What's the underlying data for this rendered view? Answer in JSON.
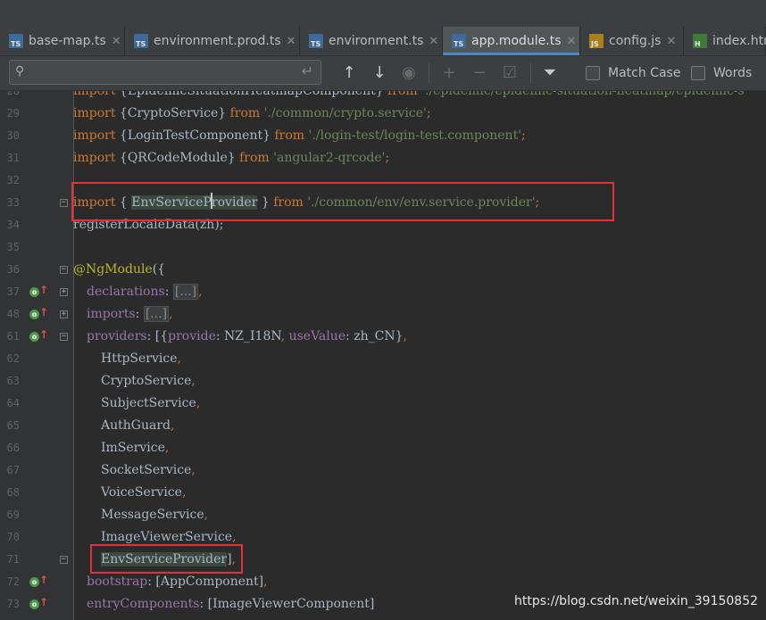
{
  "tabs": [
    {
      "label": "base-map.ts",
      "icon": "ts",
      "active": false
    },
    {
      "label": "environment.prod.ts",
      "icon": "ts",
      "active": false
    },
    {
      "label": "environment.ts",
      "icon": "ts",
      "active": false
    },
    {
      "label": "app.module.ts",
      "icon": "ts",
      "active": true
    },
    {
      "label": "config.js",
      "icon": "js",
      "active": false
    },
    {
      "label": "index.htm",
      "icon": "html",
      "active": false
    }
  ],
  "search": {
    "value": "",
    "match_case_label": "Match Case",
    "words_label": "Words",
    "match_case_checked": false,
    "words_checked": false
  },
  "lines": [
    {
      "num": "28",
      "text": "import {EpidemicSituationHeatmapComponent} from './epidemic/epidemic-situation-heatmap/epidemic-s"
    },
    {
      "num": "29",
      "text": "import {CryptoService} from './common/crypto.service';"
    },
    {
      "num": "30",
      "text": "import {LoginTestComponent} from './login-test/login-test.component';"
    },
    {
      "num": "31",
      "text": "import {QRCodeModule} from 'angular2-qrcode';"
    },
    {
      "num": "32",
      "text": ""
    },
    {
      "num": "33",
      "text": "import { EnvServiceProvider } from './common/env/env.service.provider';"
    },
    {
      "num": "34",
      "text": "registerLocaleData(zh);"
    },
    {
      "num": "35",
      "text": ""
    },
    {
      "num": "36",
      "text": "@NgModule({"
    },
    {
      "num": "37",
      "text": "declarations: [...],"
    },
    {
      "num": "48",
      "text": "imports: [...],"
    },
    {
      "num": "61",
      "text": "providers: [{provide: NZ_I18N, useValue: zh_CN},"
    },
    {
      "num": "62",
      "text": "HttpService,"
    },
    {
      "num": "63",
      "text": "CryptoService,"
    },
    {
      "num": "64",
      "text": "SubjectService,"
    },
    {
      "num": "65",
      "text": "AuthGuard,"
    },
    {
      "num": "66",
      "text": "ImService,"
    },
    {
      "num": "67",
      "text": "SocketService,"
    },
    {
      "num": "68",
      "text": "VoiceService,"
    },
    {
      "num": "69",
      "text": "MessageService,"
    },
    {
      "num": "70",
      "text": "ImageViewerService,"
    },
    {
      "num": "71",
      "text": "EnvServiceProvider],"
    },
    {
      "num": "72",
      "text": "bootstrap: [AppComponent],"
    },
    {
      "num": "73",
      "text": "entryComponents: [ImageViewerComponent]"
    }
  ],
  "code": {
    "l28": {
      "kw1": "import",
      "mid": " {EpidemicSituationHeatmapComponent} ",
      "kw2": "from",
      "str": " './epidemic/epidemic-situation-heatmap/epidemic-s"
    },
    "l29": {
      "kw1": "import",
      "mid": " {CryptoService} ",
      "kw2": "from",
      "str": " './common/crypto.service'",
      "end": ";"
    },
    "l30": {
      "kw1": "import",
      "mid": " {LoginTestComponent} ",
      "kw2": "from",
      "str": " './login-test/login-test.component'",
      "end": ";"
    },
    "l31": {
      "kw1": "import",
      "mid": " {QRCodeModule} ",
      "kw2": "from",
      "str": " 'angular2-qrcode'",
      "end": ";"
    },
    "l33": {
      "kw1": "import",
      "mid1": " { ",
      "hl_a": "EnvServiceP",
      "hl_b": "rovider",
      "mid2": " } ",
      "kw2": "from",
      "str": " './common/env/env.service.provider'",
      "end": ";"
    },
    "l34": {
      "text": "registerLocaleData(zh);"
    },
    "l36": {
      "ann": "@NgModule",
      "rest": "({"
    },
    "l37": {
      "prop": "declarations",
      "colon": ": ",
      "fold": "[...]",
      "end": ","
    },
    "l48": {
      "prop": "imports",
      "colon": ": ",
      "fold": "[...]",
      "end": ","
    },
    "l61": {
      "prop": "providers",
      "a": ": [{",
      "prop2": "provide",
      "b": ": NZ_I18N",
      "c": ", ",
      "prop3": "useValue",
      "d": ": zh_CN}",
      "e": ","
    },
    "l62": {
      "name": "HttpService",
      "end": ","
    },
    "l63": {
      "name": "CryptoService",
      "end": ","
    },
    "l64": {
      "name": "SubjectService",
      "end": ","
    },
    "l65": {
      "name": "AuthGuard",
      "end": ","
    },
    "l66": {
      "name": "ImService",
      "end": ","
    },
    "l67": {
      "name": "SocketService",
      "end": ","
    },
    "l68": {
      "name": "VoiceService",
      "end": ","
    },
    "l69": {
      "name": "MessageService",
      "end": ","
    },
    "l70": {
      "name": "ImageViewerService",
      "end": ","
    },
    "l71": {
      "name": "EnvServiceProvider",
      "rest": "]",
      "end": ","
    },
    "l72": {
      "prop": "bootstrap",
      "rest": ": [AppComponent]",
      "end": ","
    },
    "l73": {
      "prop": "entryComponents",
      "rest": ": [ImageViewerComponent]"
    }
  },
  "watermark": "https://blog.csdn.net/weixin_39150852",
  "colors": {
    "background": "#2b2b2b",
    "keyword": "#cc7832",
    "string": "#6a8759",
    "annotation": "#bbb529",
    "property": "#9876aa",
    "highlight_box": "#e0343a"
  }
}
